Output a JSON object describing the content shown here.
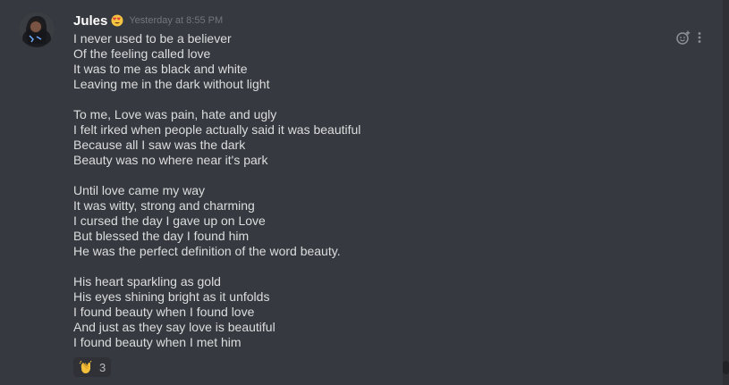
{
  "message": {
    "author": "Jules",
    "author_emoji_icon": "heart-eyes-emoji-icon",
    "timestamp": "Yesterday at 8:55 PM",
    "stanzas": [
      [
        "I never used to be a believer",
        "Of the feeling called love",
        "It was to me as black and white",
        "Leaving me in the dark without light"
      ],
      [
        "To me, Love was pain, hate and ugly",
        "I felt irked when people actually said it was beautiful",
        "Because all I saw was the dark",
        "Beauty was no where near it's park"
      ],
      [
        "Until love came my way",
        "It was witty, strong and charming",
        "I cursed the day I gave up on Love",
        "But blessed the day I found him",
        "He was the perfect definition of the word beauty."
      ],
      [
        "His heart sparkling as gold",
        "His eyes shining bright as it unfolds",
        "I found beauty when I found love",
        "And just as they say love is beautiful",
        "I found beauty when I met him"
      ]
    ]
  },
  "reaction": {
    "emoji_icon": "clapping-hands-emoji-icon",
    "count": "3"
  },
  "actions": {
    "add_reaction_icon": "add-reaction-icon",
    "more_icon": "more-options-icon"
  },
  "colors": {
    "background": "#36393f",
    "username": "#ffffff",
    "text": "#dcddde",
    "timestamp": "#72767d",
    "reaction_bg": "#2f3136"
  }
}
